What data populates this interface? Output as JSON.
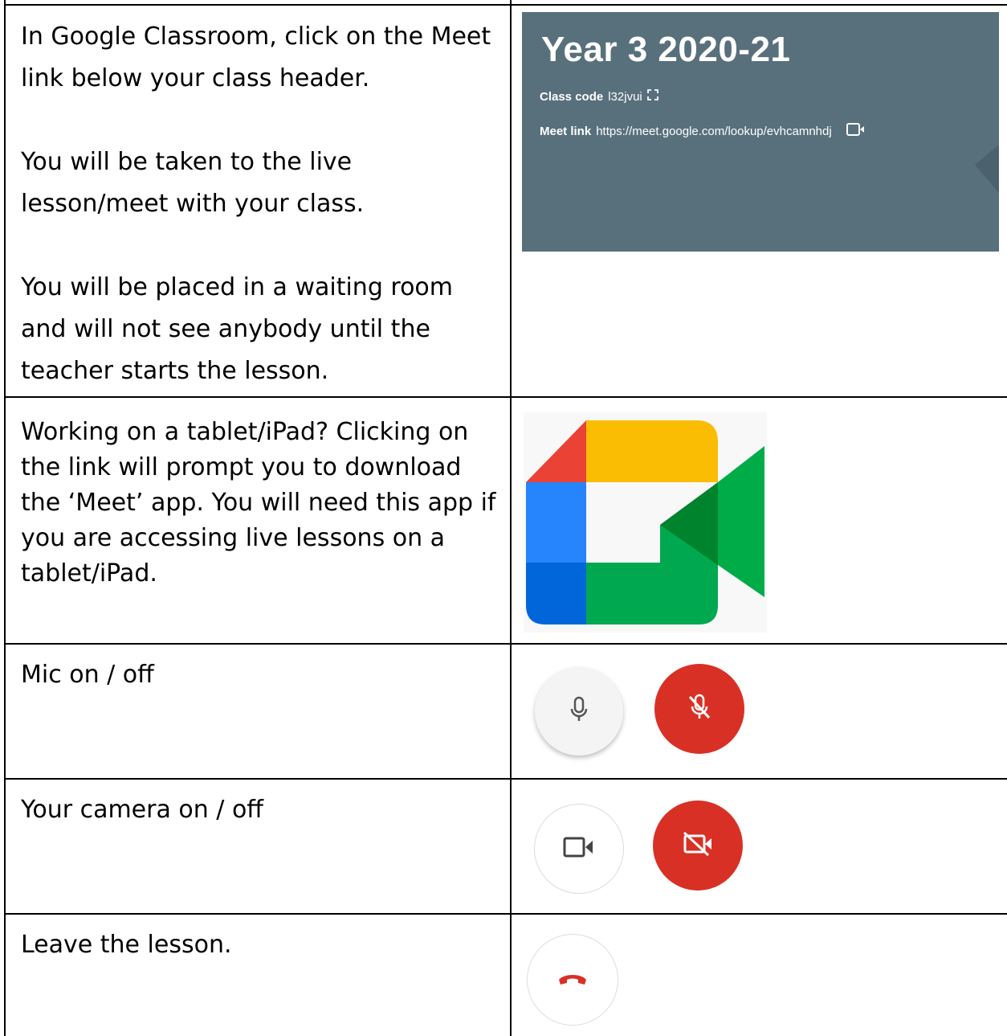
{
  "rows": {
    "classroom": {
      "para1": "In Google Classroom, click on the Meet link below your class header.",
      "para2": "You will be taken to the live lesson/meet with your class.",
      "para3": "You will be placed in a waiting room and will not see anybody until the teacher starts the lesson."
    },
    "tablet": {
      "text": "Working on a tablet/iPad? Clicking on the link will prompt you to download the ‘Meet’ app.  You will need this app if you are accessing live lessons on a tablet/iPad."
    },
    "mic": {
      "text": "Mic on / off"
    },
    "camera": {
      "text": "Your camera on / off"
    },
    "leave": {
      "text": "Leave the lesson."
    }
  },
  "banner": {
    "title": "Year 3 2020-21",
    "class_code_label": "Class code",
    "class_code_value": "l32jvui",
    "meet_link_label": "Meet link",
    "meet_link_value": "https://meet.google.com/lookup/evhcamnhdj"
  },
  "icons": {
    "expand": "expand-icon",
    "video": "video-camera-icon",
    "mic_on": "microphone-icon",
    "mic_off": "microphone-off-icon",
    "cam_on": "camera-icon",
    "cam_off": "camera-off-icon",
    "hangup": "hang-up-phone-icon",
    "logo": "google-meet-logo"
  },
  "colors": {
    "banner_bg": "#58707c",
    "red": "#d93025",
    "meet_green": "#00a94f",
    "meet_yellow": "#fbbc04",
    "meet_blue": "#2684fc",
    "meet_red": "#ea4335"
  }
}
